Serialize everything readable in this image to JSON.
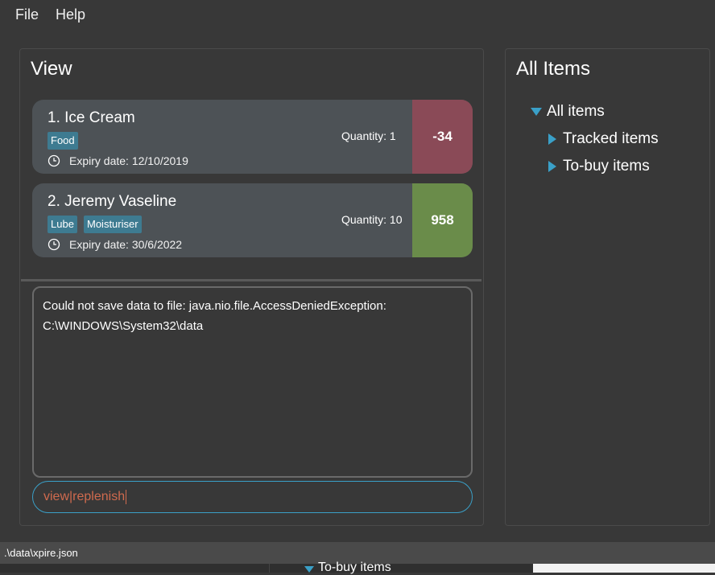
{
  "menu": {
    "file": "File",
    "help": "Help"
  },
  "view_panel": {
    "title": "View",
    "items": [
      {
        "name": "1.  Ice Cream",
        "tags": [
          "Food"
        ],
        "expiry": "Expiry date: 12/10/2019",
        "quantity": "Quantity: 1",
        "days": "-34",
        "days_color": "#8a4a57"
      },
      {
        "name": "2.  Jeremy Vaseline",
        "tags": [
          "Lube",
          "Moisturiser"
        ],
        "expiry": "Expiry date: 30/6/2022",
        "quantity": "Quantity: 10",
        "days": "958",
        "days_color": "#6a8c4a"
      }
    ],
    "result_message": "Could not save data to file: java.nio.file.AccessDeniedException:\nC:\\WINDOWS\\System32\\data",
    "command_text": "view|replenish"
  },
  "all_items_panel": {
    "title": "All Items",
    "tree": {
      "root": "All items",
      "children": [
        "Tracked items",
        "To-buy items"
      ]
    }
  },
  "status_bar": {
    "path": ".\\data\\xpire.json"
  },
  "background_window": {
    "partial_text": "To-buy items"
  },
  "colors": {
    "accent": "#3aa0c8",
    "tag": "#3e7b91",
    "card": "#4d5256",
    "command_text": "#d06a4e"
  },
  "icons": [
    "clock-icon",
    "expand-down-icon",
    "collapse-right-icon"
  ]
}
